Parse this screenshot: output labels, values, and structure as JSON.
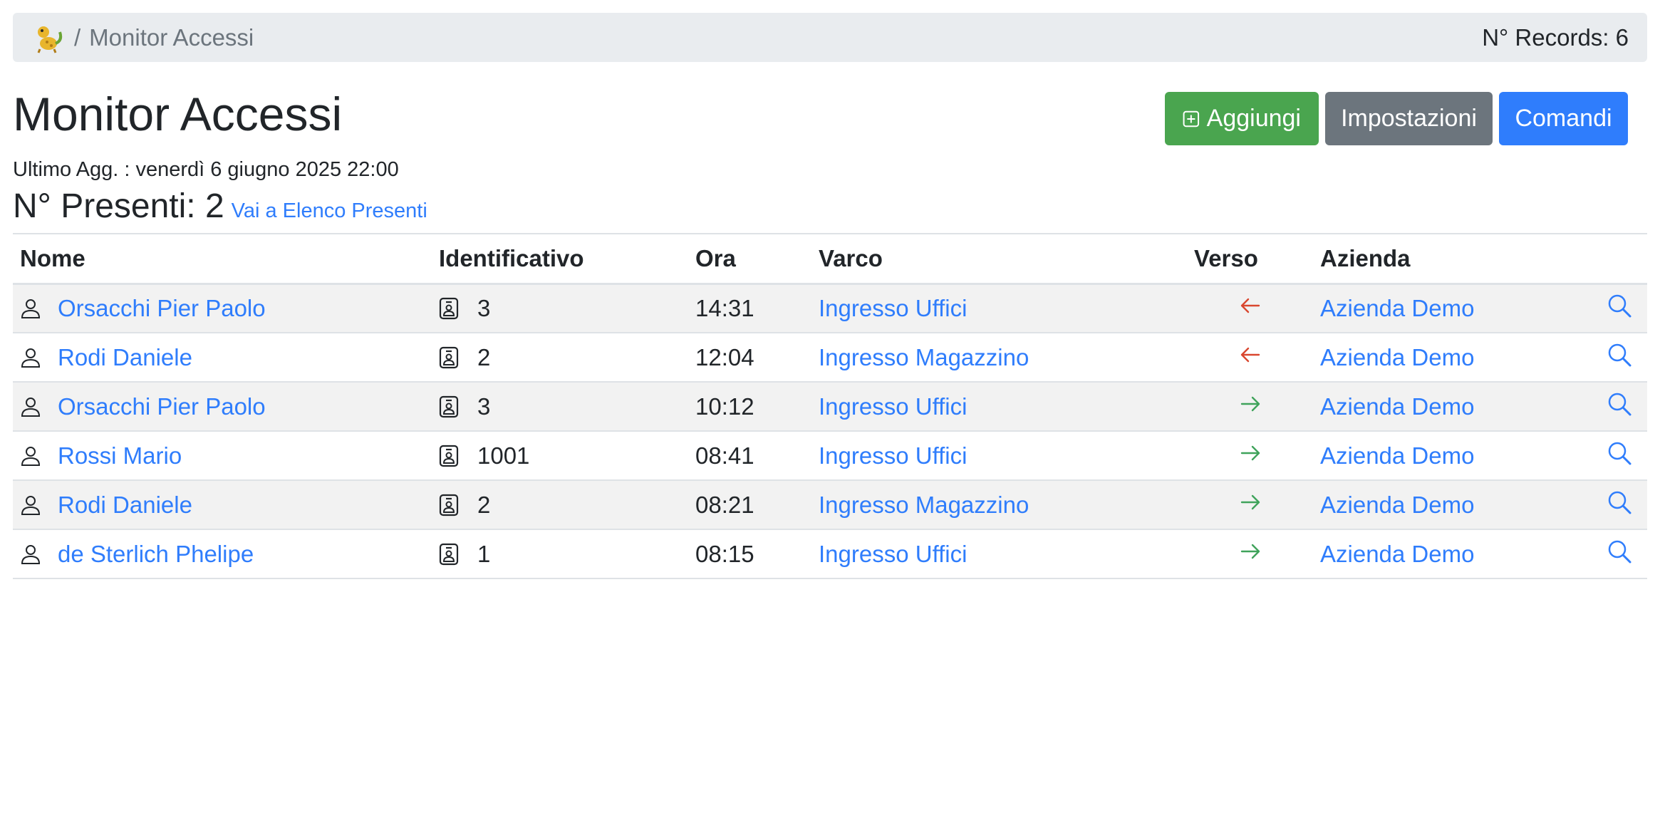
{
  "header": {
    "breadcrumb_separator": "/",
    "breadcrumb_current": "Monitor Accessi",
    "records_label": "N° Records: 6"
  },
  "page": {
    "title": "Monitor Accessi",
    "last_update": "Ultimo Agg. : venerdì 6 giugno 2025 22:00",
    "presenti_label": "N° Presenti: 2",
    "presenti_link": "Vai a Elenco Presenti"
  },
  "toolbar": {
    "add_label": "Aggiungi",
    "settings_label": "Impostazioni",
    "commands_label": "Comandi"
  },
  "colors": {
    "success": "#4aa54f",
    "secondary": "#6c757d",
    "primary": "#2f7dfc",
    "arrow_in": "#3fa35b",
    "arrow_out": "#d9472f"
  },
  "table": {
    "columns": [
      "Nome",
      "Identificativo",
      "Ora",
      "Varco",
      "Verso",
      "Azienda",
      ""
    ],
    "rows": [
      {
        "nome": "Orsacchi Pier Paolo",
        "id": "3",
        "ora": "14:31",
        "varco": "Ingresso Uffici",
        "verso": "out",
        "azienda": "Azienda Demo"
      },
      {
        "nome": "Rodi Daniele",
        "id": "2",
        "ora": "12:04",
        "varco": "Ingresso Magazzino",
        "verso": "out",
        "azienda": "Azienda Demo"
      },
      {
        "nome": "Orsacchi Pier Paolo",
        "id": "3",
        "ora": "10:12",
        "varco": "Ingresso Uffici",
        "verso": "in",
        "azienda": "Azienda Demo"
      },
      {
        "nome": "Rossi Mario",
        "id": "1001",
        "ora": "08:41",
        "varco": "Ingresso Uffici",
        "verso": "in",
        "azienda": "Azienda Demo"
      },
      {
        "nome": "Rodi Daniele",
        "id": "2",
        "ora": "08:21",
        "varco": "Ingresso Magazzino",
        "verso": "in",
        "azienda": "Azienda Demo"
      },
      {
        "nome": "de Sterlich Phelipe",
        "id": "1",
        "ora": "08:15",
        "varco": "Ingresso Uffici",
        "verso": "in",
        "azienda": "Azienda Demo"
      }
    ]
  }
}
